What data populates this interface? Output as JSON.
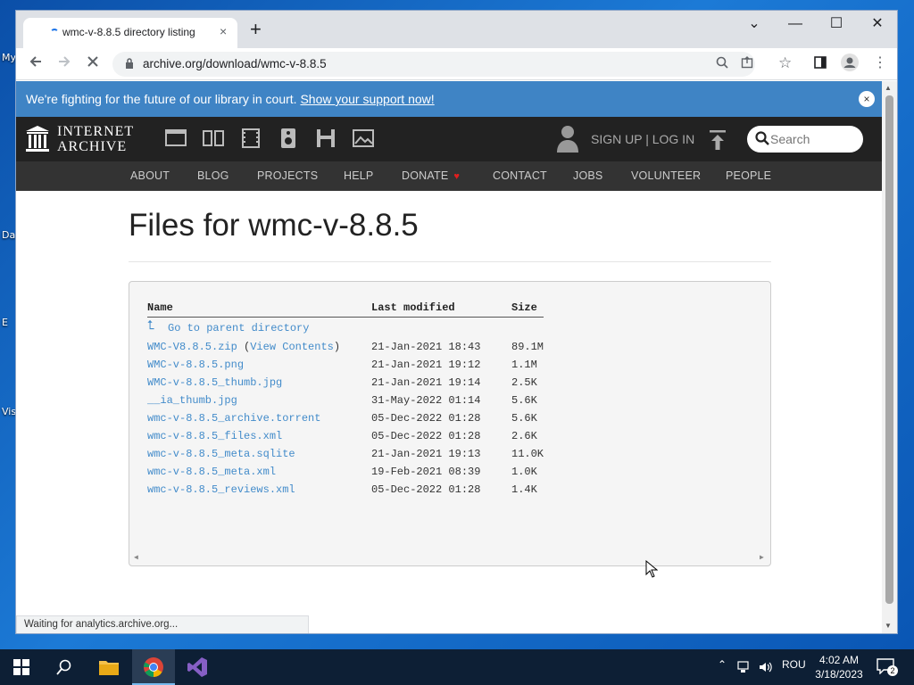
{
  "desktop": {
    "icon_labels": [
      "My",
      "Da",
      "E",
      "Vis"
    ]
  },
  "browser": {
    "tab_title": "wmc-v-8.8.5 directory listing",
    "tab_close": "×",
    "new_tab": "+",
    "url": "archive.org/download/wmc-v-8.8.5",
    "window_controls": {
      "tabsearch": "⌄",
      "minimize": "—",
      "maximize": "☐",
      "close": "✕"
    },
    "status_text": "Waiting for analytics.archive.org..."
  },
  "banner": {
    "text": "We're fighting for the future of our library in court.",
    "link": "Show your support now!",
    "close": "×"
  },
  "ia_header": {
    "logo_line1": "INTERNET",
    "logo_line2": "ARCHIVE",
    "media_icons": [
      "web-icon",
      "texts-icon",
      "video-icon",
      "audio-icon",
      "software-icon",
      "images-icon"
    ],
    "signup": "SIGN UP | LOG IN",
    "search_placeholder": "Search"
  },
  "nav": {
    "items": [
      "ABOUT",
      "BLOG",
      "PROJECTS",
      "HELP",
      "DONATE",
      "CONTACT",
      "JOBS",
      "VOLUNTEER",
      "PEOPLE"
    ]
  },
  "page": {
    "title": "Files for wmc-v-8.8.5"
  },
  "listing": {
    "headers": {
      "name": "Name",
      "modified": "Last modified",
      "size": "Size"
    },
    "parent_arrow": "⮤",
    "parent_label": "Go to parent directory",
    "files": [
      {
        "name": "WMC-V8.8.5.zip",
        "extra_open": " (",
        "extra_link": "View Contents",
        "extra_close": ")",
        "date": "21-Jan-2021 18:43",
        "size": "89.1M"
      },
      {
        "name": "WMC-v-8.8.5.png",
        "date": "21-Jan-2021 19:12",
        "size": "1.1M"
      },
      {
        "name": "WMC-v-8.8.5_thumb.jpg",
        "date": "21-Jan-2021 19:14",
        "size": "2.5K"
      },
      {
        "name": "__ia_thumb.jpg",
        "date": "31-May-2022 01:14",
        "size": "5.6K"
      },
      {
        "name": "wmc-v-8.8.5_archive.torrent",
        "date": "05-Dec-2022 01:28",
        "size": "5.6K"
      },
      {
        "name": "wmc-v-8.8.5_files.xml",
        "date": "05-Dec-2022 01:28",
        "size": "2.6K"
      },
      {
        "name": "wmc-v-8.8.5_meta.sqlite",
        "date": "21-Jan-2021 19:13",
        "size": "11.0K"
      },
      {
        "name": "wmc-v-8.8.5_meta.xml",
        "date": "19-Feb-2021 08:39",
        "size": "1.0K"
      },
      {
        "name": "wmc-v-8.8.5_reviews.xml",
        "date": "05-Dec-2022 01:28",
        "size": "1.4K"
      }
    ]
  },
  "taskbar": {
    "lang": "ROU",
    "time": "4:02 AM",
    "date": "3/18/2023",
    "notif_count": "2"
  },
  "colors": {
    "banner": "#3f84c5",
    "ia_header": "#222222",
    "link": "#428bca",
    "taskbar": "#0d1f35"
  }
}
